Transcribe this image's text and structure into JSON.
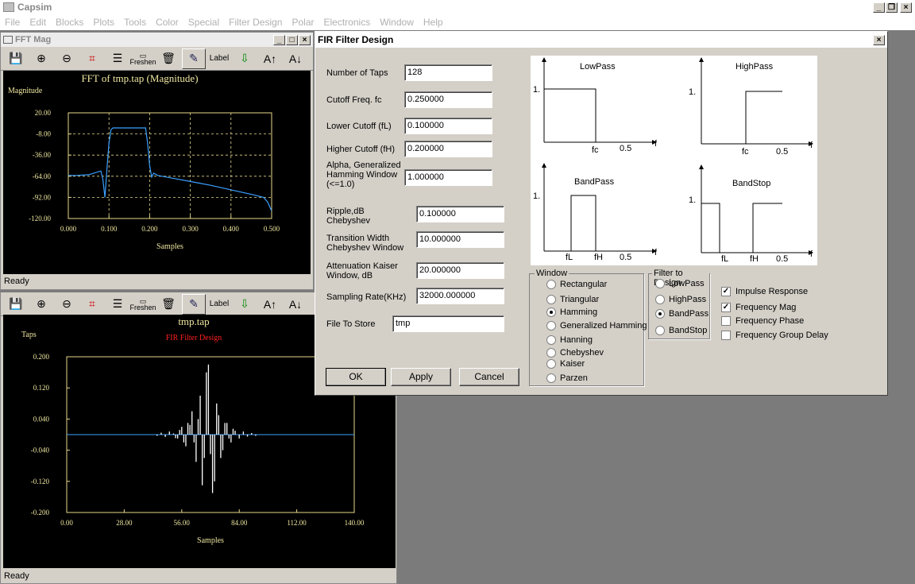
{
  "app": {
    "title": "Capsim",
    "menus": [
      "File",
      "Edit",
      "Blocks",
      "Plots",
      "Tools",
      "Color",
      "Special",
      "Filter Design",
      "Polar",
      "Electronics",
      "Window",
      "Help"
    ]
  },
  "toolbar": {
    "freshen": "Freshen",
    "label": "Label"
  },
  "fft_window": {
    "title": "FFT Mag",
    "status": "Ready",
    "chart_data": {
      "type": "line",
      "title": "FFT of tmp.tap (Magnitude)",
      "ylabel": "Magnitude",
      "xlabel": "Samples",
      "xlim": [
        0,
        0.5
      ],
      "ylim": [
        -120,
        20
      ],
      "xticks": [
        "0.000",
        "0.100",
        "0.200",
        "0.300",
        "0.400",
        "0.500"
      ],
      "yticks": [
        "20.00",
        "-8.00",
        "-36.00",
        "-64.00",
        "-92.00",
        "-120.00"
      ],
      "x": [
        0,
        0.02,
        0.05,
        0.08,
        0.085,
        0.09,
        0.095,
        0.1,
        0.105,
        0.11,
        0.15,
        0.19,
        0.195,
        0.2,
        0.205,
        0.21,
        0.22,
        0.25,
        0.3,
        0.35,
        0.4,
        0.45,
        0.48,
        0.49,
        0.5
      ],
      "y": [
        -63,
        -63,
        -62,
        -57,
        -68,
        -92,
        -55,
        -20,
        -2,
        0,
        0,
        0,
        -20,
        -50,
        -65,
        -60,
        -63,
        -66,
        -71,
        -76,
        -82,
        -88,
        -92,
        -98,
        -110
      ],
      "grid": true,
      "color": "#3ba0ff"
    }
  },
  "tap_window": {
    "title": "tmp.tap",
    "status": "Ready",
    "chart_data": {
      "type": "line",
      "title": "tmp.tap",
      "subtitle": "FIR Filter Design",
      "ylabel": "Taps",
      "xlabel": "Samples",
      "xlim": [
        0,
        140
      ],
      "ylim": [
        -0.2,
        0.2
      ],
      "xticks": [
        "0.00",
        "28.00",
        "56.00",
        "84.00",
        "112.00",
        "140.00"
      ],
      "yticks": [
        "0.200",
        "0.120",
        "0.040",
        "-0.040",
        "-0.120",
        "-0.200"
      ],
      "taps": [
        [
          44,
          -0.003
        ],
        [
          46,
          0.005
        ],
        [
          48,
          -0.006
        ],
        [
          50,
          0.008
        ],
        [
          52,
          0.003
        ],
        [
          53,
          -0.009
        ],
        [
          54,
          -0.01
        ],
        [
          55,
          0.012
        ],
        [
          56,
          0.02
        ],
        [
          57,
          -0.02
        ],
        [
          58,
          -0.03
        ],
        [
          59,
          0.03
        ],
        [
          60,
          0.025
        ],
        [
          61,
          0.06
        ],
        [
          62,
          -0.02
        ],
        [
          63,
          -0.07
        ],
        [
          64,
          0.04
        ],
        [
          65,
          0.1
        ],
        [
          66,
          -0.13
        ],
        [
          67,
          -0.06
        ],
        [
          68,
          0.16
        ],
        [
          69,
          0.18
        ],
        [
          70,
          -0.05
        ],
        [
          71,
          -0.15
        ],
        [
          72,
          -0.12
        ],
        [
          73,
          0.08
        ],
        [
          74,
          0.05
        ],
        [
          75,
          -0.06
        ],
        [
          76,
          -0.04
        ],
        [
          77,
          0.03
        ],
        [
          78,
          0.03
        ],
        [
          79,
          -0.01
        ],
        [
          80,
          -0.02
        ],
        [
          81,
          0.015
        ],
        [
          82,
          0.01
        ],
        [
          84,
          -0.01
        ],
        [
          86,
          0.008
        ],
        [
          88,
          -0.005
        ],
        [
          90,
          0.004
        ],
        [
          92,
          -0.003
        ]
      ],
      "color": "#ffffff",
      "baseline_color": "#3ba0ff"
    }
  },
  "dialog": {
    "title": "FIR Filter Design",
    "fields": [
      {
        "label": "Number of Taps",
        "value": "128"
      },
      {
        "label": "Cutoff Freq. fc",
        "value": "0.250000"
      },
      {
        "label": "Lower Cutoff (fL)",
        "value": "0.100000"
      },
      {
        "label": "Higher Cutoff (fH)",
        "value": "0.200000"
      },
      {
        "label": "Alpha, Generalized Hamming Window (<=1.0)",
        "value": "1.000000"
      },
      {
        "label": "Ripple,dB Chebyshev",
        "value": "0.100000"
      },
      {
        "label": "Transition Width Chebyshev Window",
        "value": "10.000000"
      },
      {
        "label": "Attenuation Kaiser Window, dB",
        "value": "20.000000"
      },
      {
        "label": "Sampling Rate(KHz)",
        "value": "32000.000000"
      },
      {
        "label": "File To Store",
        "value": "tmp"
      }
    ],
    "buttons": {
      "ok": "OK",
      "apply": "Apply",
      "cancel": "Cancel"
    },
    "diagrams": {
      "lowpass": {
        "title": "LowPass",
        "one": "1.",
        "fc": "fc",
        "half": "0.5",
        "f": "f"
      },
      "highpass": {
        "title": "HighPass",
        "one": "1.",
        "fc": "fc",
        "half": "0.5",
        "f": "f"
      },
      "bandpass": {
        "title": "BandPass",
        "one": "1.",
        "fl": "fL",
        "fh": "fH",
        "half": "0.5",
        "f": "f"
      },
      "bandstop": {
        "title": "BandStop",
        "one": "1.",
        "fl": "fL",
        "fh": "fH",
        "half": "0.5",
        "f": "f"
      }
    },
    "window_group": {
      "label": "Window",
      "options": [
        "Rectangular",
        "Triangular",
        "Hamming",
        "Generalized Hamming",
        "Hanning",
        "Chebyshev",
        "Kaiser",
        "Parzen"
      ],
      "selected": "Hamming"
    },
    "filter_group": {
      "label": "Filter to Design",
      "options": [
        "LowPass",
        "HighPass",
        "BandPass",
        "BandStop"
      ],
      "selected": "BandPass"
    },
    "checks": [
      {
        "label": "Impulse Response",
        "checked": true
      },
      {
        "label": "Frequency Mag",
        "checked": true
      },
      {
        "label": "Frequency Phase",
        "checked": false
      },
      {
        "label": "Frequency Group Delay",
        "checked": false
      }
    ]
  }
}
